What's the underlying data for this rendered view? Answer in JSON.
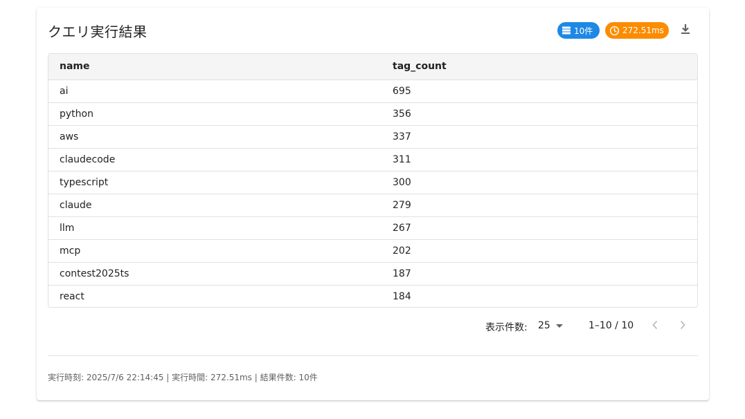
{
  "card": {
    "title": "クエリ実行結果",
    "count_badge": "10件",
    "time_badge": "272.51ms"
  },
  "colors": {
    "count_badge": "#1e88e5",
    "time_badge": "#fb8c00"
  },
  "icons": {
    "count": "list-icon",
    "time": "clock-icon",
    "download": "download-icon",
    "prev": "chevron-left-icon",
    "next": "chevron-right-icon",
    "select": "caret-down-icon"
  },
  "table": {
    "headers": [
      "name",
      "tag_count"
    ],
    "rows": [
      [
        "ai",
        "695"
      ],
      [
        "python",
        "356"
      ],
      [
        "aws",
        "337"
      ],
      [
        "claudecode",
        "311"
      ],
      [
        "typescript",
        "300"
      ],
      [
        "claude",
        "279"
      ],
      [
        "llm",
        "267"
      ],
      [
        "mcp",
        "202"
      ],
      [
        "contest2025ts",
        "187"
      ],
      [
        "react",
        "184"
      ]
    ]
  },
  "pagination": {
    "rows_per_page_label": "表示件数:",
    "rows_per_page_value": "25",
    "range": "1–10 / 10"
  },
  "footer": {
    "text": "実行時刻: 2025/7/6 22:14:45 | 実行時間: 272.51ms | 結果件数: 10件"
  }
}
